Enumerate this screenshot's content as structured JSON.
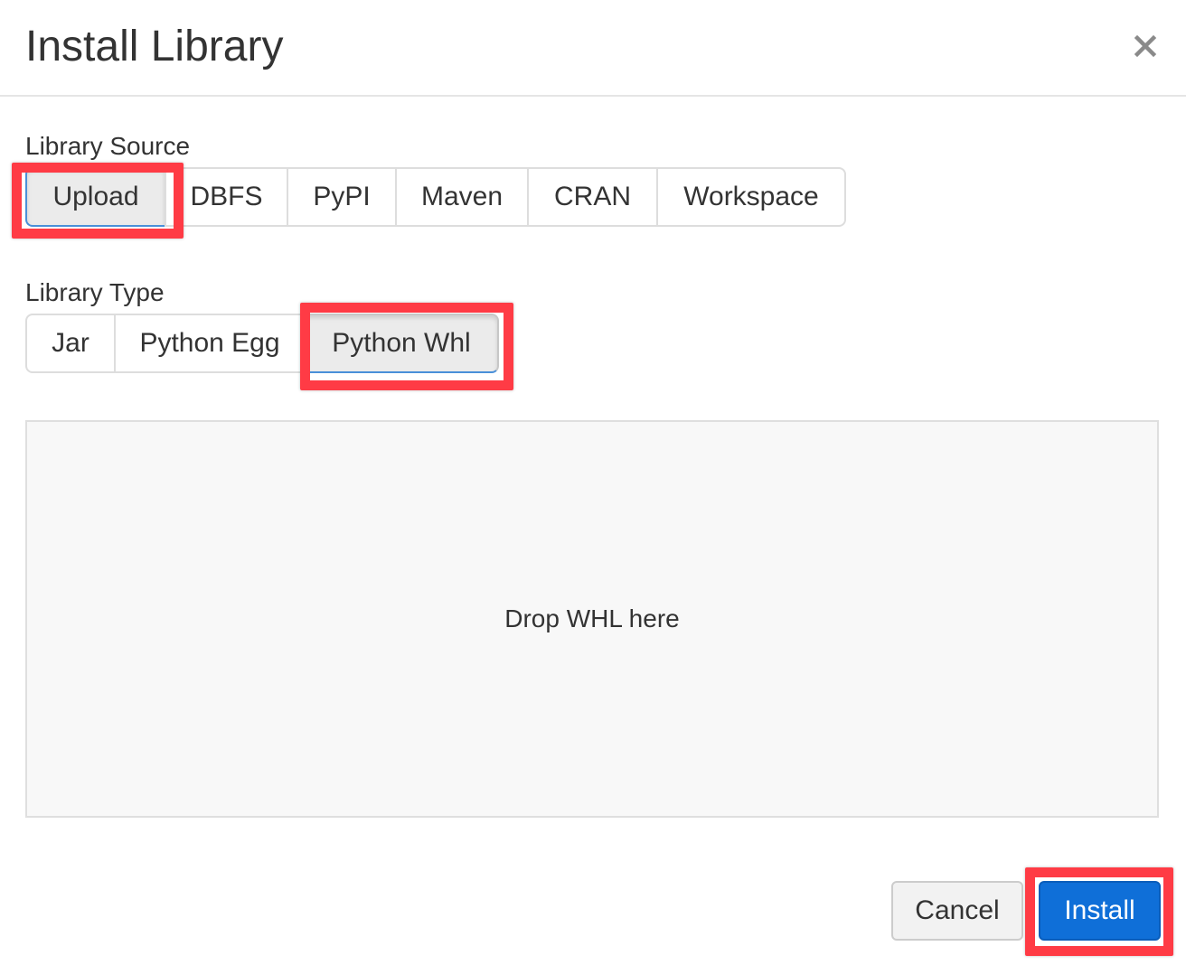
{
  "dialog": {
    "title": "Install Library",
    "close_icon": "close-icon"
  },
  "library_source": {
    "label": "Library Source",
    "options": [
      "Upload",
      "DBFS",
      "PyPI",
      "Maven",
      "CRAN",
      "Workspace"
    ],
    "selected": "Upload"
  },
  "library_type": {
    "label": "Library Type",
    "options": [
      "Jar",
      "Python Egg",
      "Python Whl"
    ],
    "selected": "Python Whl"
  },
  "dropzone": {
    "text": "Drop WHL here"
  },
  "footer": {
    "cancel_label": "Cancel",
    "install_label": "Install",
    "install_color": "#0f6fd8"
  },
  "annotations": {
    "highlight_color": "#ff3b45",
    "highlighted": [
      "Upload",
      "Python Whl",
      "Install"
    ]
  }
}
